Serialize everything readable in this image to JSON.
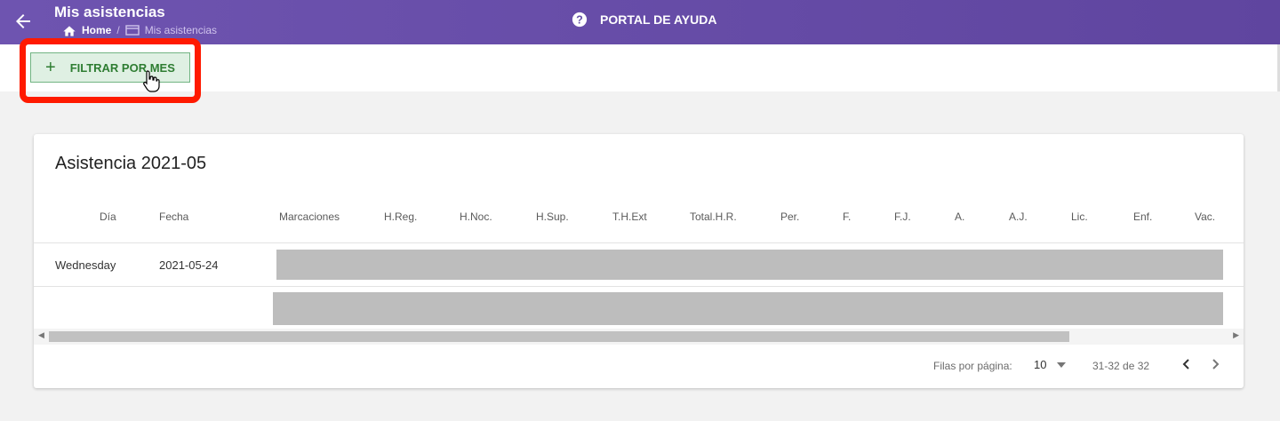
{
  "header": {
    "title": "Mis asistencias",
    "breadcrumb": {
      "home": "Home",
      "separator": "/",
      "current": "Mis asistencias"
    },
    "help_label": "PORTAL DE AYUDA",
    "colors": {
      "bar": "#6a50ac",
      "accent_green": "#2e7d32",
      "highlight": "#ff1a00"
    }
  },
  "toolbar": {
    "filter_label": "FILTRAR POR MES",
    "filter_icon": "plus-icon"
  },
  "card": {
    "title": "Asistencia 2021-05",
    "columns": [
      "Día",
      "Fecha",
      "Marcaciones",
      "H.Reg.",
      "H.Noc.",
      "H.Sup.",
      "T.H.Ext",
      "Total.H.R.",
      "Per.",
      "F.",
      "F.J.",
      "A.",
      "A.J.",
      "Lic.",
      "Enf.",
      "Vac."
    ],
    "rows": [
      {
        "dia": "Wednesday",
        "fecha": "2021-05-24"
      },
      {
        "dia": "",
        "fecha": ""
      }
    ],
    "footer": {
      "rows_per_page_label": "Filas por página:",
      "rows_per_page_value": "10",
      "range": "31-32 de 32"
    }
  }
}
